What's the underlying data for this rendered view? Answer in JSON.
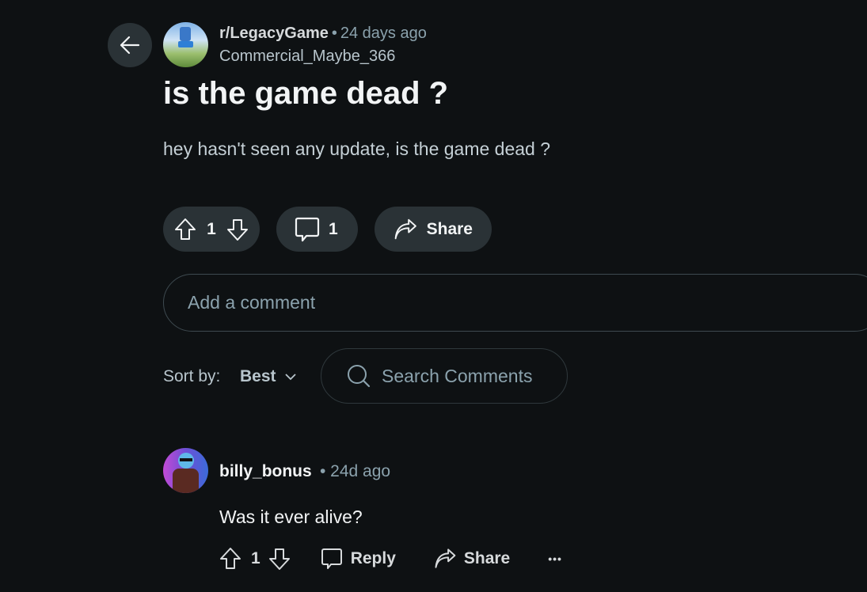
{
  "post": {
    "subreddit": "r/LegacyGame",
    "separator": "•",
    "time": "24 days ago",
    "author": "Commercial_Maybe_366",
    "title": "is the game dead ?",
    "body": "hey hasn't seen any update, is the game dead ?",
    "score": "1",
    "comment_count": "1",
    "share_label": "Share"
  },
  "comment_box": {
    "placeholder": "Add a comment"
  },
  "sort": {
    "label": "Sort by:",
    "selected": "Best"
  },
  "search": {
    "placeholder": "Search Comments"
  },
  "comments": [
    {
      "username": "billy_bonus",
      "time": "• 24d ago",
      "body": "Was it ever alive?",
      "score": "1",
      "reply_label": "Reply",
      "share_label": "Share",
      "more_label": "•••"
    }
  ],
  "icons": {
    "back": "arrow-left-icon",
    "upvote": "arrow-up-icon",
    "downvote": "arrow-down-icon",
    "comment": "speech-bubble-icon",
    "share": "share-arrow-icon",
    "search": "search-icon",
    "sort": "chevron-down-icon",
    "more": "ellipsis-icon"
  },
  "colors": {
    "background": "#0e1113",
    "pill": "#2a3236",
    "muted_text": "#8ba2ad"
  }
}
